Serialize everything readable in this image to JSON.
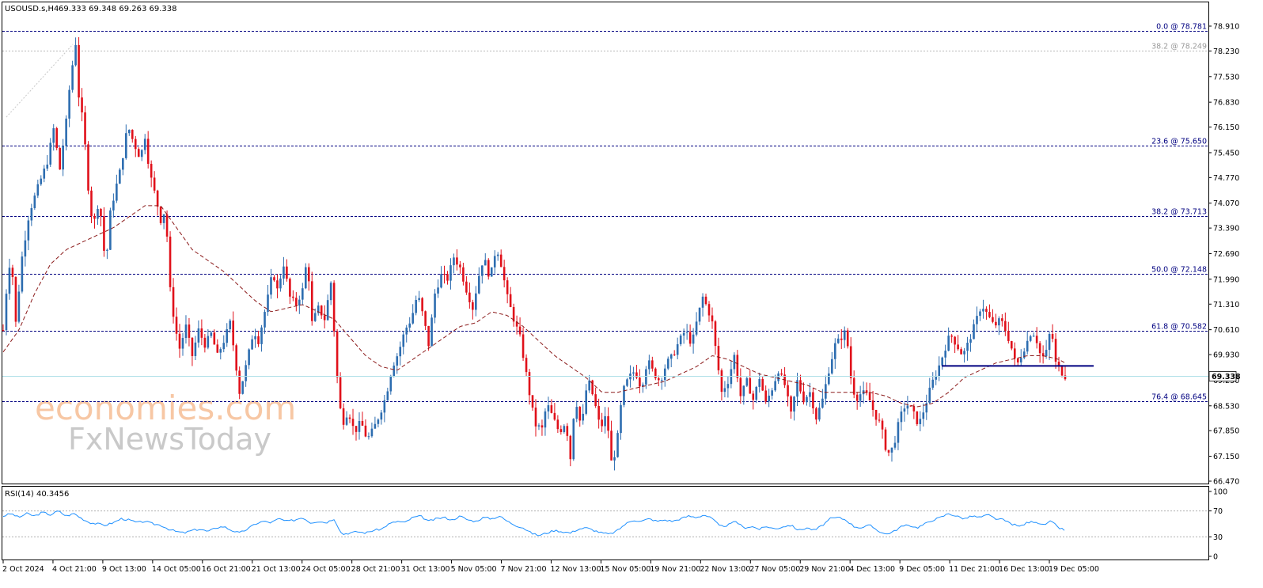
{
  "header": {
    "symbol_title": "USOUSD.s,H4",
    "ohlc": "69.333 69.348 69.263 69.338"
  },
  "watermark": {
    "brand_top": "economies.com",
    "brand_bottom": "FxNewsToday"
  },
  "chart_data": {
    "type": "candlestick",
    "symbol": "USOUSD.s",
    "timeframe": "H4",
    "price_axis": {
      "ticks": [
        "78.910",
        "78.230",
        "77.530",
        "76.830",
        "76.150",
        "75.450",
        "74.770",
        "74.070",
        "73.390",
        "72.690",
        "71.990",
        "71.310",
        "70.610",
        "69.930",
        "69.230",
        "68.530",
        "67.850",
        "67.150",
        "66.470"
      ],
      "range": [
        66.4,
        79.05
      ]
    },
    "time_axis": {
      "labels": [
        "2 Oct 2024",
        "4 Oct 21:00",
        "9 Oct 13:00",
        "14 Oct 05:00",
        "16 Oct 21:00",
        "21 Oct 13:00",
        "24 Oct 05:00",
        "28 Oct 21:00",
        "31 Oct 13:00",
        "5 Nov 05:00",
        "7 Nov 21:00",
        "12 Nov 13:00",
        "15 Nov 05:00",
        "19 Nov 21:00",
        "22 Nov 13:00",
        "27 Nov 05:00",
        "29 Nov 21:00",
        "4 Dec 13:00",
        "9 Dec 05:00",
        "11 Dec 21:00",
        "16 Dec 13:00",
        "19 Dec 05:00"
      ]
    },
    "current_price": "69.338",
    "fibonacci_levels": [
      {
        "label": "0.0 @ 78.781",
        "price": 78.781,
        "style": "primary"
      },
      {
        "label": "38.2 @ 78.249",
        "price": 78.249,
        "style": "faded"
      },
      {
        "label": "23.6 @ 75.650",
        "price": 75.65,
        "style": "primary"
      },
      {
        "label": "38.2 @ 73.713",
        "price": 73.713,
        "style": "primary"
      },
      {
        "label": "50.0 @ 72.148",
        "price": 72.148,
        "style": "primary"
      },
      {
        "label": "61.8 @ 70.582",
        "price": 70.582,
        "style": "primary"
      },
      {
        "label": "76.4 @ 68.645",
        "price": 68.645,
        "style": "primary"
      }
    ],
    "support_line": {
      "price": 69.62,
      "from_label": "11 Dec 21:00",
      "to_label": "19 Dec 05:00"
    },
    "price_path_keypoints": [
      [
        0,
        70.6
      ],
      [
        5,
        71.9
      ],
      [
        10,
        72.7
      ],
      [
        16,
        70.8
      ],
      [
        24,
        72.6
      ],
      [
        33,
        73.8
      ],
      [
        44,
        74.5
      ],
      [
        56,
        75.2
      ],
      [
        64,
        76.1
      ],
      [
        72,
        75.0
      ],
      [
        80,
        76.3
      ],
      [
        86,
        77.6
      ],
      [
        90,
        78.1
      ],
      [
        94,
        78.78
      ],
      [
        96,
        77.0
      ],
      [
        102,
        76.2
      ],
      [
        108,
        74.5
      ],
      [
        114,
        73.4
      ],
      [
        122,
        74.2
      ],
      [
        130,
        72.3
      ],
      [
        136,
        73.8
      ],
      [
        142,
        74.4
      ],
      [
        150,
        75.1
      ],
      [
        158,
        76.2
      ],
      [
        166,
        75.7
      ],
      [
        174,
        75.3
      ],
      [
        180,
        75.9
      ],
      [
        186,
        74.9
      ],
      [
        194,
        74.2
      ],
      [
        200,
        73.6
      ],
      [
        206,
        73.9
      ],
      [
        212,
        71.7
      ],
      [
        218,
        70.7
      ],
      [
        224,
        70.1
      ],
      [
        232,
        70.7
      ],
      [
        240,
        69.9
      ],
      [
        248,
        70.6
      ],
      [
        256,
        70.2
      ],
      [
        264,
        70.5
      ],
      [
        272,
        69.9
      ],
      [
        280,
        70.3
      ],
      [
        288,
        70.8
      ],
      [
        294,
        69.9
      ],
      [
        300,
        68.9
      ],
      [
        306,
        69.4
      ],
      [
        312,
        70.0
      ],
      [
        318,
        70.6
      ],
      [
        324,
        70.3
      ],
      [
        330,
        70.9
      ],
      [
        336,
        71.5
      ],
      [
        342,
        72.2
      ],
      [
        348,
        71.7
      ],
      [
        356,
        72.4
      ],
      [
        364,
        71.5
      ],
      [
        372,
        71.3
      ],
      [
        380,
        71.7
      ],
      [
        386,
        72.6
      ],
      [
        392,
        70.8
      ],
      [
        400,
        71.2
      ],
      [
        408,
        70.9
      ],
      [
        416,
        71.9
      ],
      [
        424,
        69.3
      ],
      [
        430,
        68.0
      ],
      [
        438,
        68.4
      ],
      [
        446,
        67.8
      ],
      [
        454,
        68.1
      ],
      [
        462,
        67.6
      ],
      [
        470,
        67.9
      ],
      [
        478,
        68.3
      ],
      [
        486,
        68.8
      ],
      [
        494,
        69.6
      ],
      [
        502,
        70.0
      ],
      [
        510,
        70.6
      ],
      [
        518,
        70.9
      ],
      [
        526,
        71.6
      ],
      [
        534,
        70.9
      ],
      [
        540,
        70.2
      ],
      [
        548,
        71.6
      ],
      [
        556,
        72.1
      ],
      [
        564,
        72.0
      ],
      [
        572,
        72.6
      ],
      [
        580,
        72.3
      ],
      [
        588,
        71.7
      ],
      [
        596,
        71.2
      ],
      [
        604,
        72.1
      ],
      [
        610,
        72.6
      ],
      [
        618,
        72.0
      ],
      [
        626,
        72.9
      ],
      [
        632,
        72.4
      ],
      [
        640,
        71.5
      ],
      [
        648,
        70.9
      ],
      [
        656,
        70.4
      ],
      [
        664,
        69.4
      ],
      [
        670,
        68.6
      ],
      [
        676,
        68.0
      ],
      [
        684,
        67.9
      ],
      [
        690,
        68.6
      ],
      [
        698,
        68.2
      ],
      [
        706,
        67.8
      ],
      [
        714,
        68.1
      ],
      [
        720,
        67.1
      ],
      [
        726,
        68.8
      ],
      [
        734,
        67.9
      ],
      [
        742,
        69.3
      ],
      [
        750,
        68.7
      ],
      [
        758,
        67.9
      ],
      [
        766,
        68.3
      ],
      [
        772,
        67.0
      ],
      [
        778,
        67.3
      ],
      [
        786,
        68.9
      ],
      [
        794,
        69.3
      ],
      [
        802,
        69.5
      ],
      [
        810,
        69.0
      ],
      [
        818,
        69.8
      ],
      [
        826,
        69.4
      ],
      [
        834,
        69.2
      ],
      [
        842,
        69.7
      ],
      [
        850,
        69.9
      ],
      [
        858,
        70.3
      ],
      [
        866,
        70.6
      ],
      [
        874,
        70.2
      ],
      [
        882,
        71.0
      ],
      [
        888,
        71.5
      ],
      [
        894,
        71.2
      ],
      [
        900,
        70.8
      ],
      [
        906,
        69.8
      ],
      [
        912,
        68.9
      ],
      [
        920,
        69.2
      ],
      [
        928,
        69.9
      ],
      [
        936,
        68.8
      ],
      [
        944,
        69.2
      ],
      [
        952,
        68.7
      ],
      [
        960,
        69.3
      ],
      [
        968,
        68.6
      ],
      [
        976,
        69.0
      ],
      [
        984,
        69.5
      ],
      [
        992,
        69.1
      ],
      [
        1000,
        68.3
      ],
      [
        1008,
        69.2
      ],
      [
        1016,
        68.7
      ],
      [
        1024,
        68.9
      ],
      [
        1032,
        68.2
      ],
      [
        1040,
        68.7
      ],
      [
        1048,
        69.5
      ],
      [
        1056,
        70.2
      ],
      [
        1064,
        70.4
      ],
      [
        1070,
        70.6
      ],
      [
        1076,
        69.3
      ],
      [
        1082,
        68.7
      ],
      [
        1090,
        68.9
      ],
      [
        1098,
        68.8
      ],
      [
        1106,
        68.3
      ],
      [
        1114,
        68.0
      ],
      [
        1122,
        67.2
      ],
      [
        1130,
        67.4
      ],
      [
        1138,
        68.2
      ],
      [
        1146,
        68.6
      ],
      [
        1154,
        68.4
      ],
      [
        1162,
        68.0
      ],
      [
        1170,
        68.5
      ],
      [
        1178,
        69.1
      ],
      [
        1186,
        69.5
      ],
      [
        1194,
        70.0
      ],
      [
        1202,
        70.5
      ],
      [
        1210,
        70.2
      ],
      [
        1218,
        69.9
      ],
      [
        1226,
        70.3
      ],
      [
        1234,
        70.8
      ],
      [
        1242,
        71.3
      ],
      [
        1250,
        71.0
      ],
      [
        1258,
        70.7
      ],
      [
        1266,
        70.9
      ],
      [
        1274,
        70.5
      ],
      [
        1280,
        70.1
      ],
      [
        1286,
        69.6
      ],
      [
        1292,
        69.9
      ],
      [
        1298,
        70.2
      ],
      [
        1306,
        70.6
      ],
      [
        1312,
        70.3
      ],
      [
        1318,
        69.8
      ],
      [
        1324,
        70.0
      ],
      [
        1330,
        70.7
      ],
      [
        1336,
        69.7
      ],
      [
        1342,
        69.5
      ],
      [
        1347,
        69.338
      ]
    ],
    "moving_average_keypoints": [
      [
        0,
        70.0
      ],
      [
        20,
        70.6
      ],
      [
        40,
        71.6
      ],
      [
        60,
        72.4
      ],
      [
        80,
        72.8
      ],
      [
        100,
        73.0
      ],
      [
        120,
        73.2
      ],
      [
        140,
        73.4
      ],
      [
        160,
        73.7
      ],
      [
        180,
        74.0
      ],
      [
        200,
        74.0
      ],
      [
        220,
        73.4
      ],
      [
        240,
        72.8
      ],
      [
        260,
        72.5
      ],
      [
        280,
        72.2
      ],
      [
        300,
        71.8
      ],
      [
        320,
        71.4
      ],
      [
        340,
        71.1
      ],
      [
        360,
        71.2
      ],
      [
        380,
        71.3
      ],
      [
        400,
        71.1
      ],
      [
        420,
        70.9
      ],
      [
        440,
        70.4
      ],
      [
        460,
        69.9
      ],
      [
        480,
        69.6
      ],
      [
        500,
        69.5
      ],
      [
        520,
        69.8
      ],
      [
        540,
        70.1
      ],
      [
        560,
        70.4
      ],
      [
        580,
        70.7
      ],
      [
        600,
        70.8
      ],
      [
        620,
        71.1
      ],
      [
        640,
        71.0
      ],
      [
        660,
        70.7
      ],
      [
        680,
        70.3
      ],
      [
        700,
        69.9
      ],
      [
        720,
        69.6
      ],
      [
        740,
        69.3
      ],
      [
        760,
        68.9
      ],
      [
        780,
        68.9
      ],
      [
        800,
        69.0
      ],
      [
        820,
        69.1
      ],
      [
        840,
        69.2
      ],
      [
        860,
        69.4
      ],
      [
        880,
        69.6
      ],
      [
        900,
        69.9
      ],
      [
        920,
        69.8
      ],
      [
        940,
        69.6
      ],
      [
        960,
        69.4
      ],
      [
        980,
        69.3
      ],
      [
        1000,
        69.2
      ],
      [
        1020,
        69.1
      ],
      [
        1040,
        68.9
      ],
      [
        1060,
        68.9
      ],
      [
        1080,
        68.9
      ],
      [
        1100,
        68.9
      ],
      [
        1120,
        68.8
      ],
      [
        1140,
        68.6
      ],
      [
        1160,
        68.5
      ],
      [
        1180,
        68.6
      ],
      [
        1200,
        68.9
      ],
      [
        1220,
        69.3
      ],
      [
        1240,
        69.5
      ],
      [
        1260,
        69.7
      ],
      [
        1280,
        69.8
      ],
      [
        1300,
        69.9
      ],
      [
        1320,
        69.9
      ],
      [
        1340,
        69.8
      ],
      [
        1348,
        69.7
      ]
    ]
  },
  "rsi_panel": {
    "label": "RSI(14) 40.3456",
    "ticks": [
      "100",
      "70",
      "30",
      "0"
    ],
    "levels": [
      70,
      30
    ],
    "rsi_keypoints": [
      [
        0,
        62
      ],
      [
        10,
        66
      ],
      [
        20,
        60
      ],
      [
        30,
        66
      ],
      [
        40,
        62
      ],
      [
        50,
        68
      ],
      [
        60,
        64
      ],
      [
        70,
        70
      ],
      [
        80,
        62
      ],
      [
        90,
        66
      ],
      [
        100,
        58
      ],
      [
        110,
        52
      ],
      [
        120,
        50
      ],
      [
        130,
        48
      ],
      [
        140,
        52
      ],
      [
        150,
        58
      ],
      [
        160,
        56
      ],
      [
        170,
        52
      ],
      [
        180,
        54
      ],
      [
        190,
        50
      ],
      [
        200,
        48
      ],
      [
        210,
        42
      ],
      [
        220,
        38
      ],
      [
        230,
        36
      ],
      [
        240,
        40
      ],
      [
        250,
        42
      ],
      [
        260,
        38
      ],
      [
        270,
        44
      ],
      [
        280,
        46
      ],
      [
        290,
        40
      ],
      [
        300,
        36
      ],
      [
        310,
        42
      ],
      [
        320,
        50
      ],
      [
        330,
        54
      ],
      [
        340,
        52
      ],
      [
        350,
        58
      ],
      [
        360,
        54
      ],
      [
        370,
        56
      ],
      [
        380,
        60
      ],
      [
        390,
        52
      ],
      [
        400,
        54
      ],
      [
        410,
        52
      ],
      [
        420,
        58
      ],
      [
        430,
        34
      ],
      [
        440,
        36
      ],
      [
        450,
        38
      ],
      [
        460,
        36
      ],
      [
        470,
        40
      ],
      [
        480,
        42
      ],
      [
        490,
        50
      ],
      [
        500,
        54
      ],
      [
        510,
        52
      ],
      [
        520,
        60
      ],
      [
        530,
        62
      ],
      [
        540,
        54
      ],
      [
        550,
        58
      ],
      [
        560,
        60
      ],
      [
        570,
        56
      ],
      [
        580,
        62
      ],
      [
        590,
        56
      ],
      [
        600,
        54
      ],
      [
        610,
        60
      ],
      [
        620,
        58
      ],
      [
        630,
        62
      ],
      [
        640,
        54
      ],
      [
        650,
        48
      ],
      [
        660,
        44
      ],
      [
        670,
        36
      ],
      [
        680,
        32
      ],
      [
        690,
        36
      ],
      [
        700,
        40
      ],
      [
        710,
        38
      ],
      [
        720,
        36
      ],
      [
        730,
        42
      ],
      [
        740,
        44
      ],
      [
        750,
        40
      ],
      [
        760,
        36
      ],
      [
        770,
        34
      ],
      [
        780,
        40
      ],
      [
        790,
        50
      ],
      [
        800,
        56
      ],
      [
        810,
        54
      ],
      [
        820,
        58
      ],
      [
        830,
        54
      ],
      [
        840,
        56
      ],
      [
        850,
        54
      ],
      [
        860,
        58
      ],
      [
        870,
        62
      ],
      [
        880,
        60
      ],
      [
        890,
        64
      ],
      [
        900,
        58
      ],
      [
        910,
        46
      ],
      [
        920,
        48
      ],
      [
        930,
        54
      ],
      [
        940,
        44
      ],
      [
        950,
        46
      ],
      [
        960,
        42
      ],
      [
        970,
        46
      ],
      [
        980,
        42
      ],
      [
        990,
        46
      ],
      [
        1000,
        48
      ],
      [
        1010,
        40
      ],
      [
        1020,
        44
      ],
      [
        1030,
        40
      ],
      [
        1040,
        48
      ],
      [
        1050,
        58
      ],
      [
        1060,
        60
      ],
      [
        1070,
        56
      ],
      [
        1080,
        46
      ],
      [
        1090,
        44
      ],
      [
        1100,
        48
      ],
      [
        1110,
        40
      ],
      [
        1120,
        34
      ],
      [
        1130,
        38
      ],
      [
        1140,
        46
      ],
      [
        1150,
        48
      ],
      [
        1160,
        44
      ],
      [
        1170,
        50
      ],
      [
        1180,
        56
      ],
      [
        1190,
        60
      ],
      [
        1200,
        66
      ],
      [
        1210,
        62
      ],
      [
        1220,
        58
      ],
      [
        1230,
        62
      ],
      [
        1240,
        60
      ],
      [
        1250,
        64
      ],
      [
        1260,
        58
      ],
      [
        1270,
        56
      ],
      [
        1280,
        50
      ],
      [
        1290,
        46
      ],
      [
        1300,
        52
      ],
      [
        1310,
        54
      ],
      [
        1320,
        48
      ],
      [
        1330,
        54
      ],
      [
        1340,
        44
      ],
      [
        1348,
        40
      ]
    ]
  }
}
